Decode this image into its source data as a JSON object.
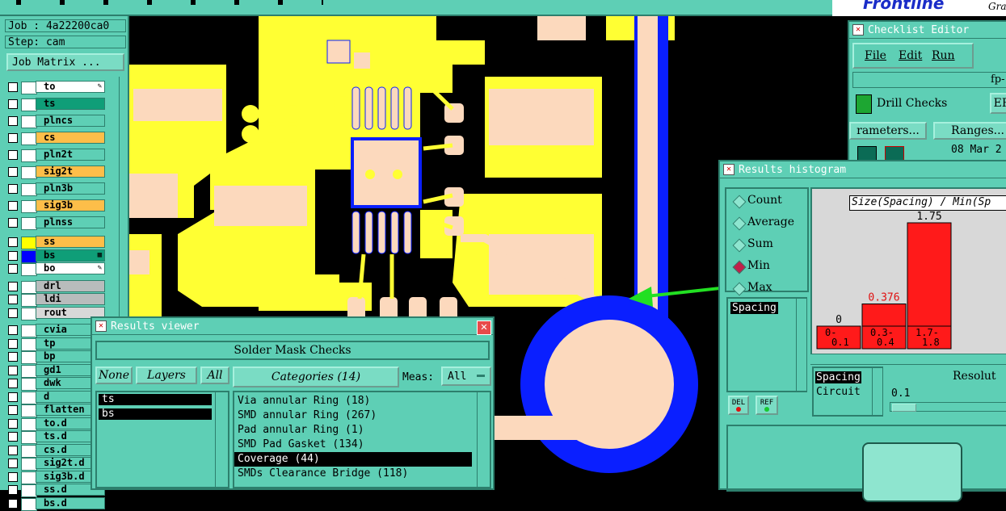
{
  "header": {
    "job_label": "Job : 4a22200ca0",
    "step_label": "Step: cam",
    "job_matrix_button": "Job Matrix ...",
    "brand_fragment": "Frontline",
    "brand_sub": "Gra"
  },
  "layers": [
    {
      "name": "to",
      "color": "#ffffff",
      "box": "#ffffff",
      "mark": "pencil"
    },
    {
      "name": "ts",
      "color": "#0f9e78",
      "box": "#ffffff",
      "mark": ""
    },
    {
      "name": "plncs",
      "color": "#5ecfb5",
      "box": "#ffffff",
      "mark": ""
    },
    {
      "name": "cs",
      "color": "#fdbe49",
      "box": "#ffffff",
      "mark": ""
    },
    {
      "name": "pln2t",
      "color": "#5ecfb5",
      "box": "#ffffff",
      "mark": ""
    },
    {
      "name": "sig2t",
      "color": "#fdbe49",
      "box": "#ffffff",
      "mark": ""
    },
    {
      "name": "pln3b",
      "color": "#5ecfb5",
      "box": "#ffffff",
      "mark": ""
    },
    {
      "name": "sig3b",
      "color": "#fdbe49",
      "box": "#ffffff",
      "mark": ""
    },
    {
      "name": "plnss",
      "color": "#5ecfb5",
      "box": "#ffffff",
      "mark": ""
    },
    {
      "name": "ss",
      "color": "#fdbe49",
      "box": "#ffff00",
      "mark": ""
    },
    {
      "name": "bs",
      "color": "#0f9e78",
      "box": "#0000ff",
      "mark": "grid"
    },
    {
      "name": "bo",
      "color": "#ffffff",
      "box": "#ffffff",
      "mark": "pencil"
    },
    {
      "name": "drl",
      "color": "#b8bcbc",
      "box": "#ffffff",
      "mark": ""
    },
    {
      "name": "ldi",
      "color": "#b8bcbc",
      "box": "#ffffff",
      "mark": ""
    },
    {
      "name": "rout",
      "color": "#d8d8d8",
      "box": "#ffffff",
      "mark": ""
    },
    {
      "name": "cvia",
      "color": "#5ecfb5",
      "box": "#ffffff",
      "mark": ""
    },
    {
      "name": "tp",
      "color": "#5ecfb5",
      "box": "#ffffff",
      "mark": ""
    },
    {
      "name": "bp",
      "color": "#5ecfb5",
      "box": "#ffffff",
      "mark": ""
    },
    {
      "name": "gd1",
      "color": "#5ecfb5",
      "box": "#ffffff",
      "mark": ""
    },
    {
      "name": "dwk",
      "color": "#5ecfb5",
      "box": "#ffffff",
      "mark": ""
    },
    {
      "name": "d",
      "color": "#5ecfb5",
      "box": "#ffffff",
      "mark": ""
    },
    {
      "name": "flatten",
      "color": "#5ecfb5",
      "box": "#ffffff",
      "mark": ""
    },
    {
      "name": "to.d",
      "color": "#5ecfb5",
      "box": "#ffffff",
      "mark": ""
    },
    {
      "name": "ts.d",
      "color": "#5ecfb5",
      "box": "#ffffff",
      "mark": ""
    },
    {
      "name": "cs.d",
      "color": "#5ecfb5",
      "box": "#ffffff",
      "mark": ""
    },
    {
      "name": "sig2t.d",
      "color": "#5ecfb5",
      "box": "#ffffff",
      "mark": ""
    },
    {
      "name": "sig3b.d",
      "color": "#5ecfb5",
      "box": "#ffffff",
      "mark": ""
    },
    {
      "name": "ss.d",
      "color": "#5ecfb5",
      "box": "#ffffff",
      "mark": ""
    },
    {
      "name": "bs.d",
      "color": "#5ecfb5",
      "box": "#ffffff",
      "mark": ""
    }
  ],
  "results_viewer": {
    "title": "Results viewer",
    "heading": "Solder Mask Checks",
    "none_button": "None",
    "layers_button": "Layers",
    "all_button": "All",
    "categories_button": "Categories (14)",
    "meas_label": "Meas:",
    "meas_value": "All",
    "layer_list": [
      "ts",
      "bs"
    ],
    "categories": [
      "Via annular Ring (18)",
      "SMD annular Ring (267)",
      "Pad annular Ring (1)",
      "SMD Pad Gasket (134)",
      "Coverage (44)",
      "SMDs Clearance Bridge (118)"
    ],
    "selected_category": 4
  },
  "checklist_editor": {
    "title": "Checklist Editor",
    "menu": [
      "File",
      "Edit",
      "Run"
    ],
    "fp_fragment": "fp-",
    "drill_checks_label": "Drill Checks",
    "er_fragment": "ER",
    "parameters_button": "rameters...",
    "ranges_button": "Ranges...",
    "date_fragment": "08 Mar 2"
  },
  "histogram": {
    "title": "Results histogram",
    "modes": [
      "Count",
      "Average",
      "Sum",
      "Min",
      "Max"
    ],
    "selected_mode": "Min",
    "chart_title": "Size(Spacing) / Min(Sp",
    "list_selected": "Spacing",
    "list_items": [
      "Spacing",
      "Circuit"
    ],
    "resolution_label": "Resolut",
    "resolution_value": "0.1",
    "del_button": "DEL",
    "ref_button": "REF"
  },
  "chart_data": {
    "type": "bar",
    "title": "Size(Spacing) / Min(Sp",
    "categories": [
      "0-0.1",
      "0.3-0.4",
      "1.7-1.8"
    ],
    "values": [
      0,
      0.376,
      1.75
    ],
    "value_labels": [
      "0",
      "0.376",
      "1.75"
    ],
    "tick_labels": [
      [
        "0-",
        "0.1"
      ],
      [
        "0.3-",
        "0.4"
      ],
      [
        "1.7-",
        "1.8"
      ]
    ],
    "ylim": [
      0,
      1.75
    ],
    "bar_color": "#ff1a1a"
  },
  "colors": {
    "panel": "#5ecfb5",
    "panel_dark": "#2d7f6d",
    "pcb_copper": "#ffff33",
    "pcb_pad": "#fcd9bd",
    "pcb_blue": "#0a1fff",
    "arrow": "#22e022"
  }
}
